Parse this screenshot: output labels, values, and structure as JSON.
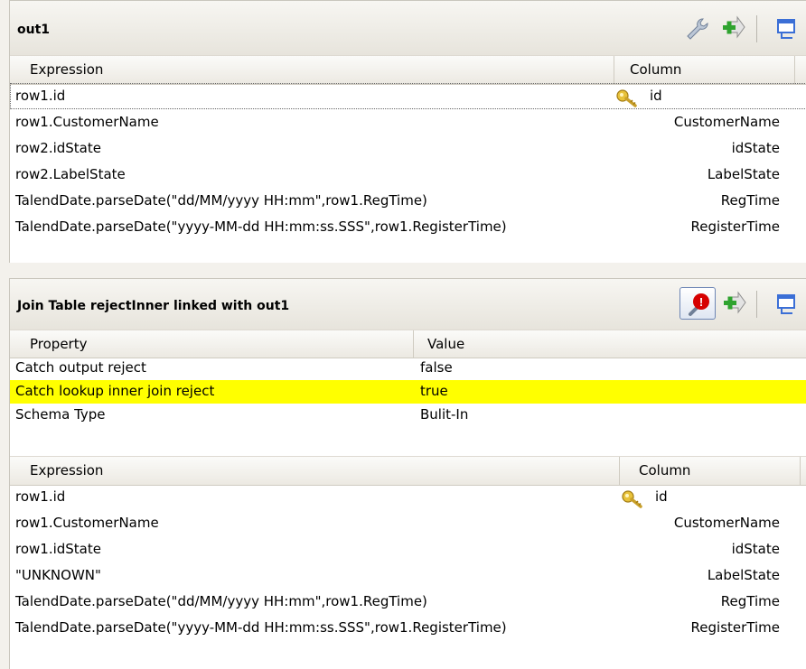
{
  "out1": {
    "title": "out1",
    "headers": {
      "expression": "Expression",
      "column": "Column"
    },
    "rows": [
      {
        "expression": "row1.id",
        "column": "id",
        "key": true
      },
      {
        "expression": "row1.CustomerName",
        "column": "CustomerName"
      },
      {
        "expression": "row2.idState",
        "column": "idState"
      },
      {
        "expression": "row2.LabelState",
        "column": "LabelState"
      },
      {
        "expression": "TalendDate.parseDate(\"dd/MM/yyyy HH:mm\",row1.RegTime)",
        "column": "RegTime"
      },
      {
        "expression": "TalendDate.parseDate(\"yyyy-MM-dd HH:mm:ss.SSS\",row1.RegisterTime)",
        "column": "RegisterTime"
      }
    ]
  },
  "join": {
    "title": "Join Table rejectInner linked with out1",
    "warning_badge": "!",
    "prop_headers": {
      "property": "Property",
      "value": "Value"
    },
    "properties": [
      {
        "property": "Catch output reject",
        "value": "false"
      },
      {
        "property": "Catch lookup inner join reject",
        "value": "true",
        "highlight": true
      },
      {
        "property": "Schema Type",
        "value": "Bulit-In"
      }
    ],
    "headers": {
      "expression": "Expression",
      "column": "Column"
    },
    "rows": [
      {
        "expression": "row1.id",
        "column": "id",
        "key": true
      },
      {
        "expression": "row1.CustomerName",
        "column": "CustomerName"
      },
      {
        "expression": "row1.idState",
        "column": "idState"
      },
      {
        "expression": "\"UNKNOWN\"",
        "column": "LabelState"
      },
      {
        "expression": "TalendDate.parseDate(\"dd/MM/yyyy HH:mm\",row1.RegTime)",
        "column": "RegTime"
      },
      {
        "expression": "TalendDate.parseDate(\"yyyy-MM-dd HH:mm:ss.SSS\",row1.RegisterTime)",
        "column": "RegisterTime"
      }
    ]
  },
  "colors": {
    "highlight": "#ffff00",
    "icon_green": "#2fa32f",
    "icon_blue": "#3b6fd6",
    "badge_red": "#d60000"
  }
}
